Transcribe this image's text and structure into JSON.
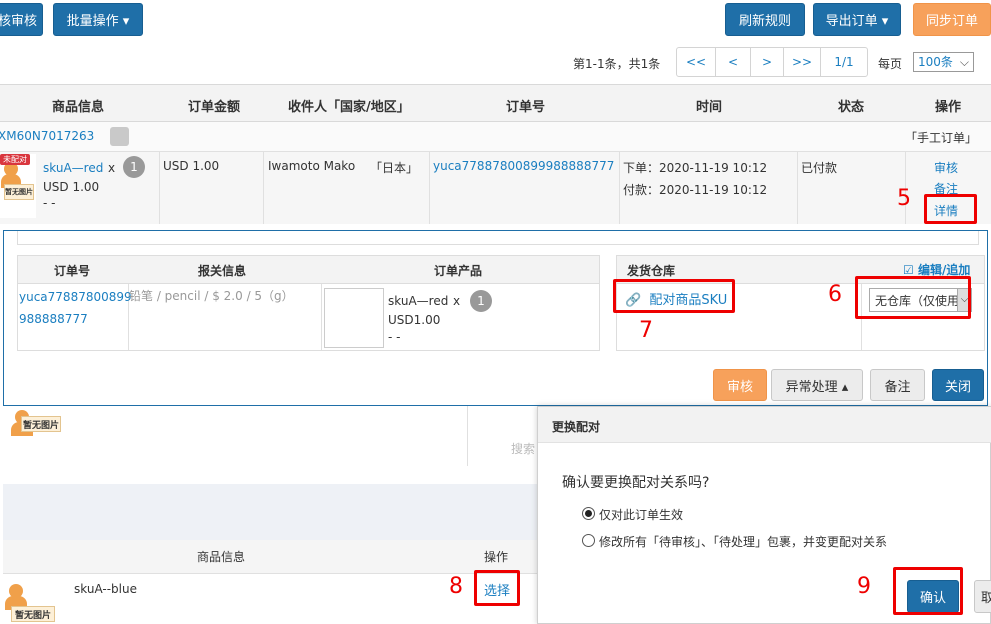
{
  "toolbar": {
    "audit_btn": "核审核",
    "batch_btn": "批量操作 ▾",
    "refresh_btn": "刷新规则",
    "export_btn": "导出订单 ▾",
    "sync_btn": "同步订单"
  },
  "pagination": {
    "summary": "第1-1条，共1条",
    "first": "<<",
    "prev": "<",
    "next": ">",
    "last": ">>",
    "page": "1/1",
    "per_page_label": "每页",
    "per_page_value": "100条"
  },
  "table_header": {
    "product": "商品信息",
    "amount": "订单金额",
    "recipient": "收件人「国家/地区」",
    "order_no": "订单号",
    "time": "时间",
    "status": "状态",
    "actions": "操作"
  },
  "order": {
    "package_no": "XM60N7017263",
    "manual_tag": "「手工订单」",
    "unmatched_badge": "未配对",
    "noimg_label": "暂无图片",
    "sku": "skuA—red",
    "qty_x": "x",
    "qty": "1",
    "price": "USD 1.00",
    "dash": "- -",
    "amount": "USD 1.00",
    "recipient": "Iwamoto Mako",
    "country": "「日本」",
    "order_no": "yuca77887800899988888777",
    "placed_time": "下单：2020-11-19 10:12",
    "paid_time": "付款：2020-11-19 10:12",
    "status": "已付款",
    "action_audit": "审核",
    "action_remark": "备注",
    "action_detail": "详情"
  },
  "detail": {
    "col_order_no": "订单号",
    "col_customs": "报关信息",
    "col_product": "订单产品",
    "col_warehouse": "发货仓库",
    "edit_add": "编辑/追加",
    "order_no_line1": "yuca77887800899",
    "order_no_line2": "988888777",
    "customs_info": "铅笔 / pencil / $ 2.0 / 5（g）",
    "sku": "skuA—red",
    "qty_x": "x",
    "qty": "1",
    "price": "USD1.00",
    "dash": "- -",
    "match_sku": "配对商品SKU",
    "warehouse_select": "无仓库（仅使用",
    "btn_audit": "审核",
    "btn_exception": "异常处理 ▴",
    "btn_remark": "备注",
    "btn_close": "关闭"
  },
  "bg_panel": {
    "noimg_label": "暂无图片",
    "search_text": "搜索",
    "col_product": "商品信息",
    "col_actions": "操作",
    "sku": "skuA--blue",
    "select_link": "选择"
  },
  "dialog": {
    "title": "更换配对",
    "question": "确认要更换配对关系吗?",
    "option1": "仅对此订单生效",
    "option2": "修改所有「待审核」、「待处理」包裹，并变更配对关系",
    "confirm_btn": "确认",
    "cancel_btn": "取"
  },
  "annotations": {
    "n5": "5",
    "n6": "6",
    "n7": "7",
    "n8": "8",
    "n9": "9"
  },
  "colors": {
    "primary_blue": "#1f6fa8",
    "orange": "#f7a15b",
    "link": "#1a7ec0",
    "highlight_red": "#e00000"
  }
}
